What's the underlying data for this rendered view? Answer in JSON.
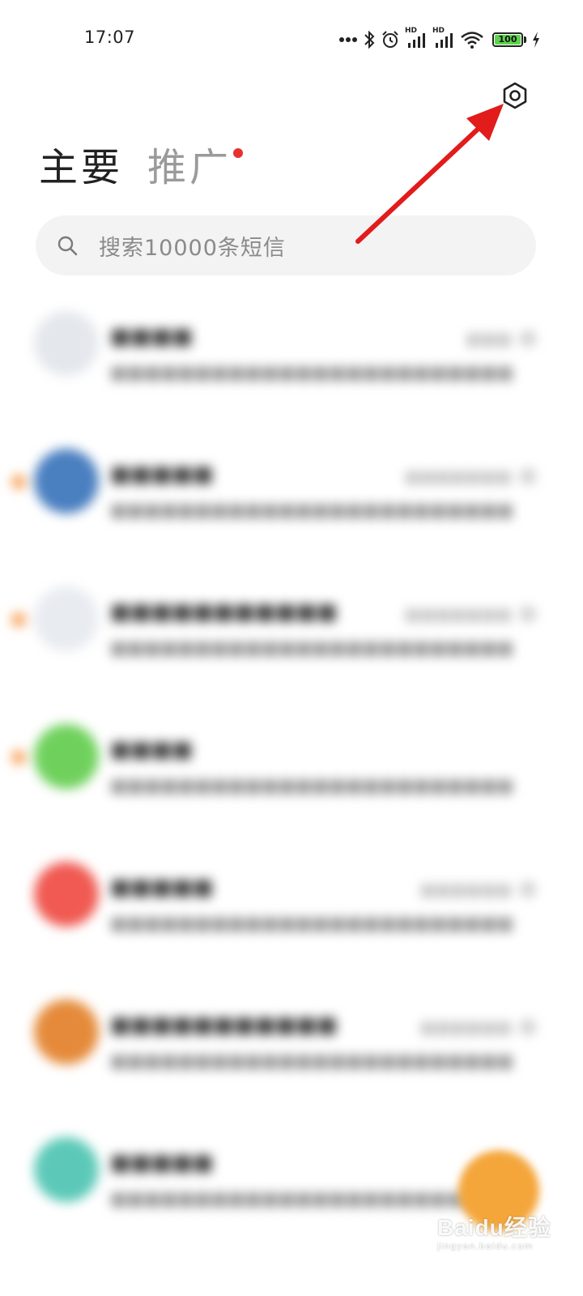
{
  "status_bar": {
    "time": "17:07",
    "battery_text": "100",
    "battery_level": 1.0,
    "icons": [
      "more-dots-icon",
      "bluetooth-icon",
      "alarm-icon",
      "hd-signal-icon",
      "hd-signal-icon",
      "wifi-icon",
      "battery-icon",
      "charging-bolt-icon"
    ],
    "hd_label": "HD"
  },
  "header": {
    "settings_icon": "settings-hex-icon"
  },
  "tabs": [
    {
      "label": "主要",
      "active": true
    },
    {
      "label": "推广",
      "active": false,
      "has_dot": true
    }
  ],
  "search": {
    "placeholder": "搜索10000条短信",
    "icon": "search-icon"
  },
  "colors": {
    "accent_dot": "#e6322e",
    "fab": "#f4a63a",
    "arrow": "#e21b1b",
    "unread": "#f7a25a"
  },
  "watermark": {
    "main": "Baidu经验",
    "sub": "jingyan.baidu.com"
  }
}
